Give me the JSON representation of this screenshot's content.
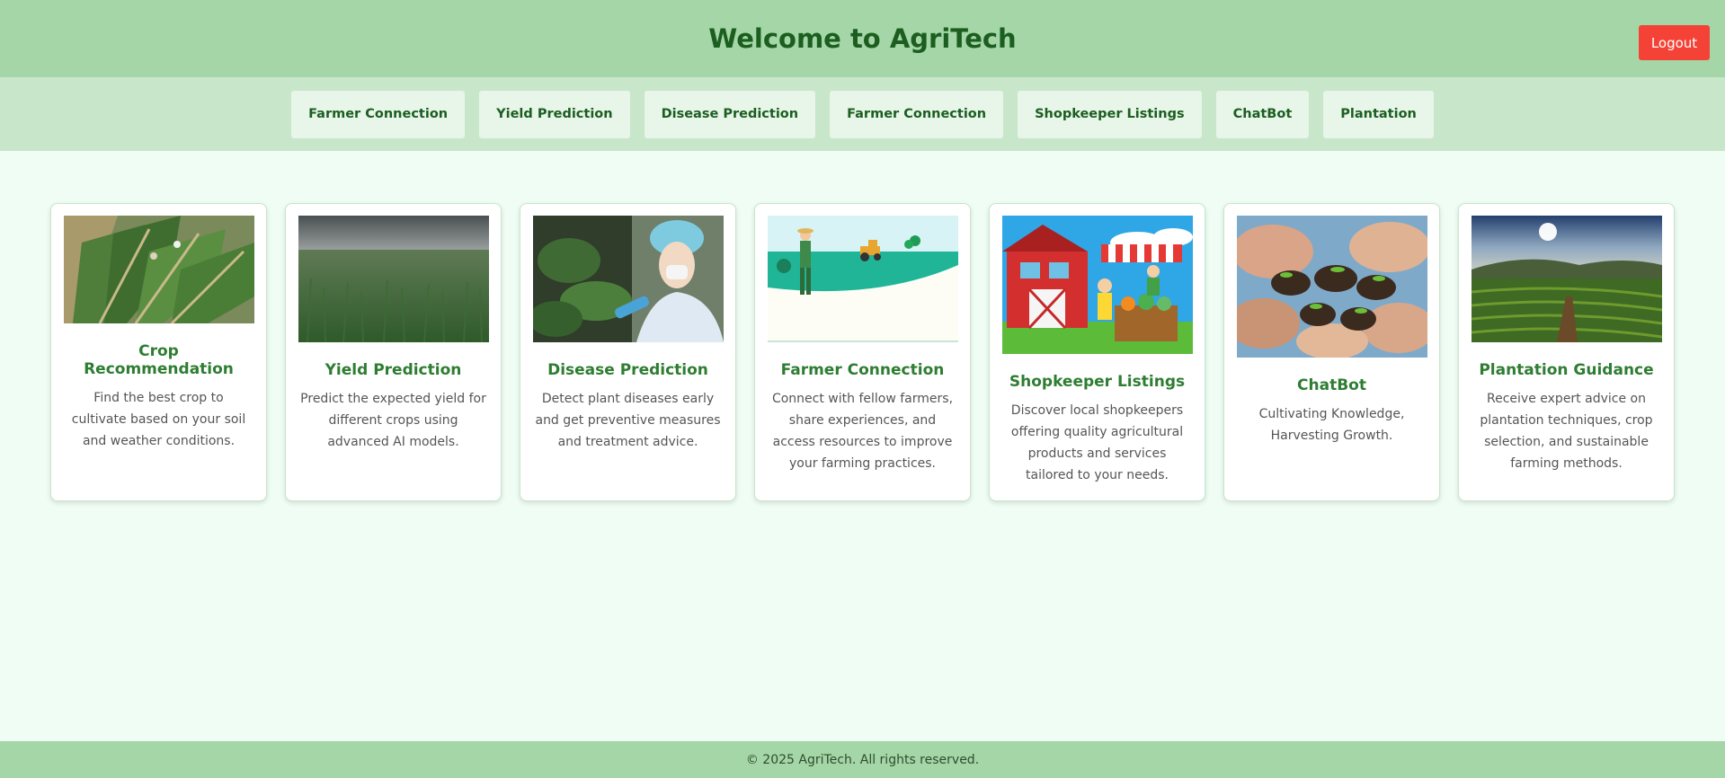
{
  "header": {
    "title": "Welcome to AgriTech",
    "logout_label": "Logout"
  },
  "nav": {
    "items": [
      {
        "label": "Farmer Connection"
      },
      {
        "label": "Yield Prediction"
      },
      {
        "label": "Disease Prediction"
      },
      {
        "label": "Farmer Connection"
      },
      {
        "label": "Shopkeeper Listings"
      },
      {
        "label": "ChatBot"
      },
      {
        "label": "Plantation"
      }
    ]
  },
  "cards": [
    {
      "title": "Crop Recommendation",
      "description": "Find the best crop to cultivate based on your soil and weather conditions."
    },
    {
      "title": "Yield Prediction",
      "description": "Predict the expected yield for different crops using advanced AI models."
    },
    {
      "title": "Disease Prediction",
      "description": "Detect plant diseases early and get preventive measures and treatment advice."
    },
    {
      "title": "Farmer Connection",
      "description": "Connect with fellow farmers, share experiences, and access resources to improve your farming practices."
    },
    {
      "title": "Shopkeeper Listings",
      "description": "Discover local shopkeepers offering quality agricultural products and services tailored to your needs."
    },
    {
      "title": "ChatBot",
      "description": "Cultivating Knowledge, Harvesting Growth."
    },
    {
      "title": "Plantation Guidance",
      "description": "Receive expert advice on plantation techniques, crop selection, and sustainable farming methods."
    }
  ],
  "footer": {
    "text": "© 2025 AgriTech. All rights reserved."
  },
  "colors": {
    "header_bg": "#a5d6a7",
    "nav_bg": "#c8e6c9",
    "page_bg": "#f0fdf4",
    "accent_green": "#2e7d32",
    "logout_red": "#f44336"
  }
}
